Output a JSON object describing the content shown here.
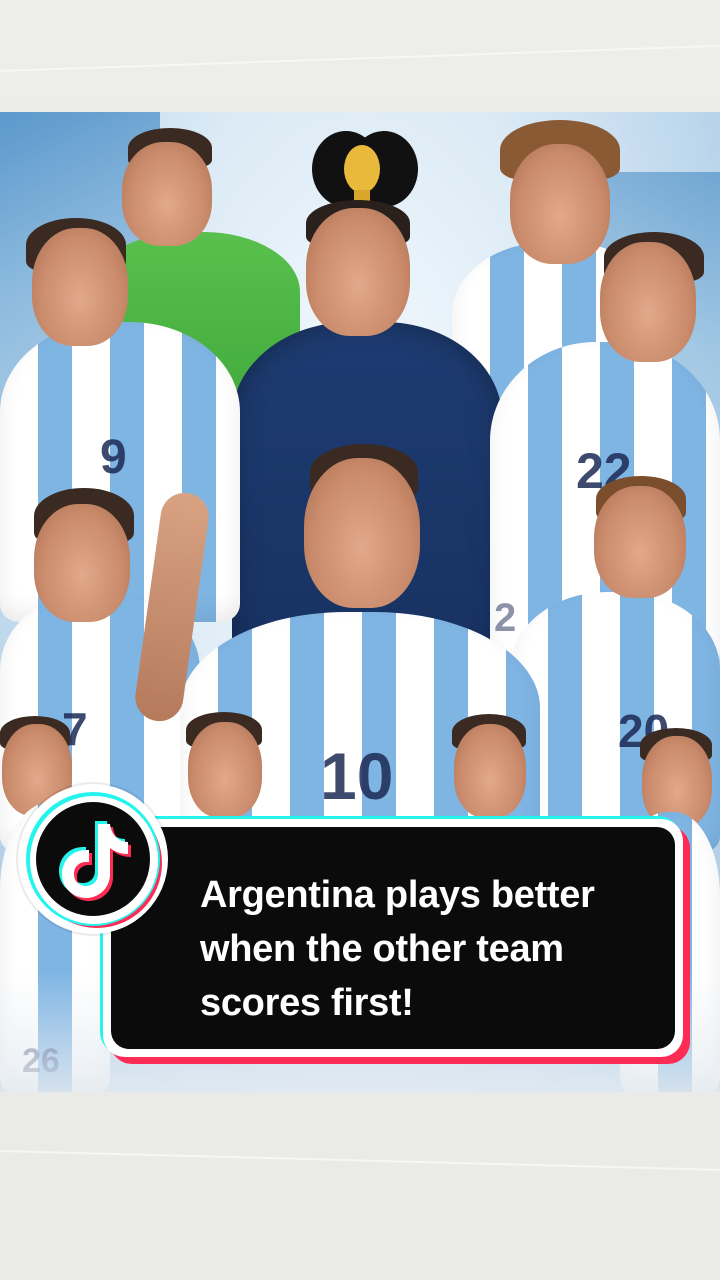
{
  "caption": {
    "lines": [
      "Argentina plays better",
      "when the other team",
      "scores first!"
    ]
  },
  "poster": {
    "jersey_numbers": [
      "9",
      "22",
      "7",
      "10",
      "20",
      "2",
      "26"
    ]
  },
  "colors": {
    "tiktok_cyan": "#25f4ee",
    "tiktok_red": "#fe2c55",
    "card_black": "#0b0b0b",
    "argentina_sky_blue": "#7fb5e3"
  },
  "icons": {
    "badge": "tiktok-logo-icon",
    "trophy": "world-cup-trophy-icon"
  }
}
